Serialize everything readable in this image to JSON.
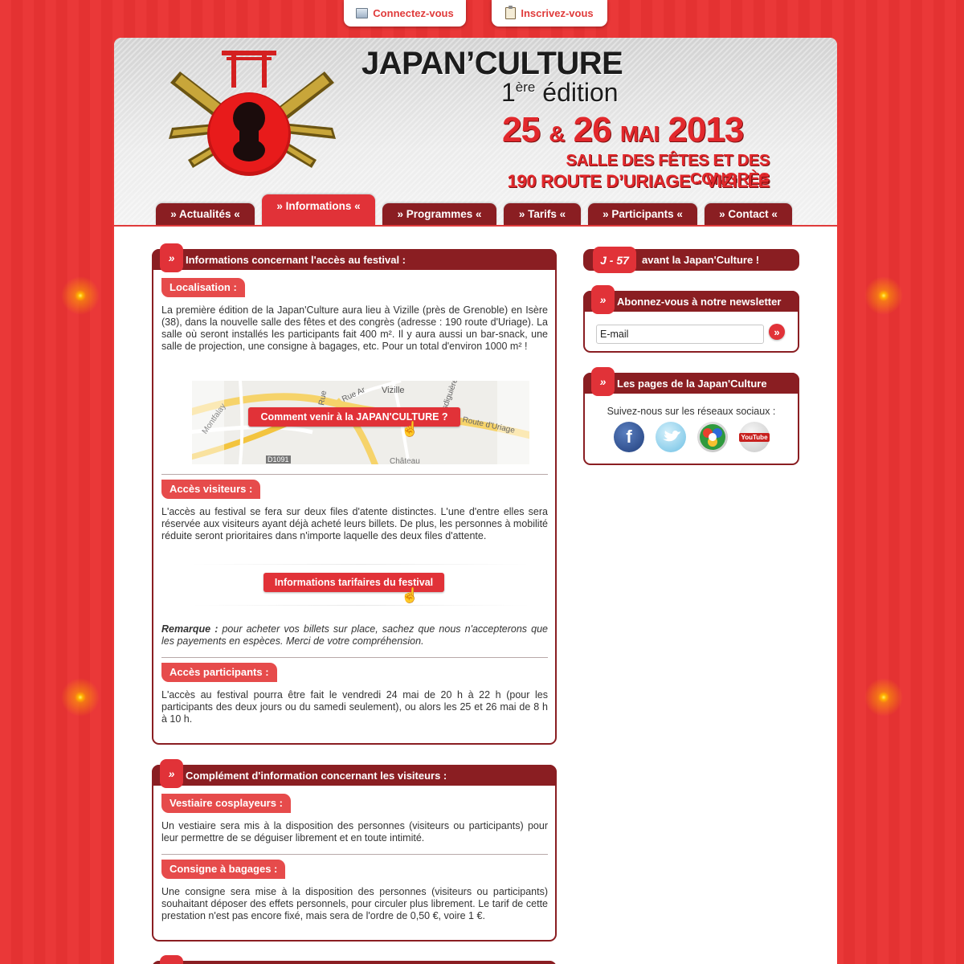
{
  "toplinks": {
    "login": "Connectez-vous",
    "register": "Inscrivez-vous"
  },
  "header": {
    "title": "JAPAN’CULTURE",
    "edition_num": "1",
    "edition_sup": "ère",
    "edition_word": "édition",
    "date_a": "25",
    "date_amp": "&",
    "date_b": "26",
    "date_month": "MAI",
    "date_year": "2013",
    "place": "SALLE DES FÊTES ET DES CONGRÈS",
    "address": "190 ROUTE D’URIAGE - VIZILLE"
  },
  "nav": [
    "» Actualités «",
    "» Informations «",
    "» Programmes «",
    "» Tarifs «",
    "» Participants «",
    "» Contact «"
  ],
  "bullet": "»",
  "access": {
    "title": "Informations concernant l'accès au festival :",
    "loc_tag": "Localisation :",
    "loc_text": "La première édition de la Japan'Culture aura lieu à Vizille (près de Grenoble) en Isère (38), dans la nouvelle salle des fêtes et des congrès (adresse : 190 route d'Uriage). La salle où seront installés les participants fait 400 m². Il y aura aussi un bar-snack, une salle de projection, une consigne à bagages, etc. Pour un total d'environ 1000 m² !",
    "map_button": "Comment venir à la JAPAN'CULTURE ?",
    "map_labels": {
      "vizille": "Vizille",
      "rue1": "Rue Ar",
      "rue2": "Rue",
      "route": "Route d'Uriage",
      "d1091": "D1091",
      "chateau": "Château",
      "lesdigu": "Lesdiguières",
      "mont": "Montfalay"
    },
    "visitors_tag": "Accès visiteurs :",
    "visitors_text": "L'accès au festival se fera sur deux files d'atente distinctes. L'une d'entre elles sera réservée aux visiteurs ayant déjà acheté leurs billets. De plus, les personnes à mobilité réduite seront prioritaires dans n'importe laquelle des deux files d'attente.",
    "tarif_button": "Informations tarifaires du festival",
    "remark_label": "Remarque :",
    "remark_text": " pour acheter vos billets sur place, sachez que nous n'accepterons que les payements en espèces. Merci de votre compréhension.",
    "participants_tag": "Accès participants :",
    "participants_text": "L'accès au festival pourra être fait le vendredi 24 mai de 20 h à 22 h (pour les participants des deux jours ou du samedi seulement), ou alors les 25 et 26 mai de 8 h à 10 h."
  },
  "visitors": {
    "title": "Complément d'information concernant les visiteurs :",
    "vest_tag": "Vestiaire cosplayeurs :",
    "vest_text": "Un vestiaire sera mis à la disposition des personnes (visiteurs ou participants) pour leur permettre de se déguiser librement et en toute intimité.",
    "bag_tag": "Consigne à bagages :",
    "bag_text": "Une consigne sera mise à la disposition des personnes (visiteurs ou participants) souhaitant déposer des effets personnels, pour circuler plus librement. Le tarif de cette prestation n'est pas encore fixé, mais sera de l'ordre de 0,50 €, voire 1 €."
  },
  "sidebar": {
    "countdown_badge": "J - 57",
    "countdown_text": "avant la Japan'Culture !",
    "newsletter_title": "Abonnez-vous à notre newsletter",
    "email_value": "E-mail",
    "submit_glyph": "»",
    "pages_title": "Les pages de la Japan'Culture",
    "follow_text": "Suivez-nous sur les réseaux sociaux :",
    "social": {
      "facebook": "f",
      "youtube": "YouTube"
    }
  },
  "colors": {
    "accent": "#e13238",
    "dark": "#8a1e22",
    "background": "#e43232"
  }
}
